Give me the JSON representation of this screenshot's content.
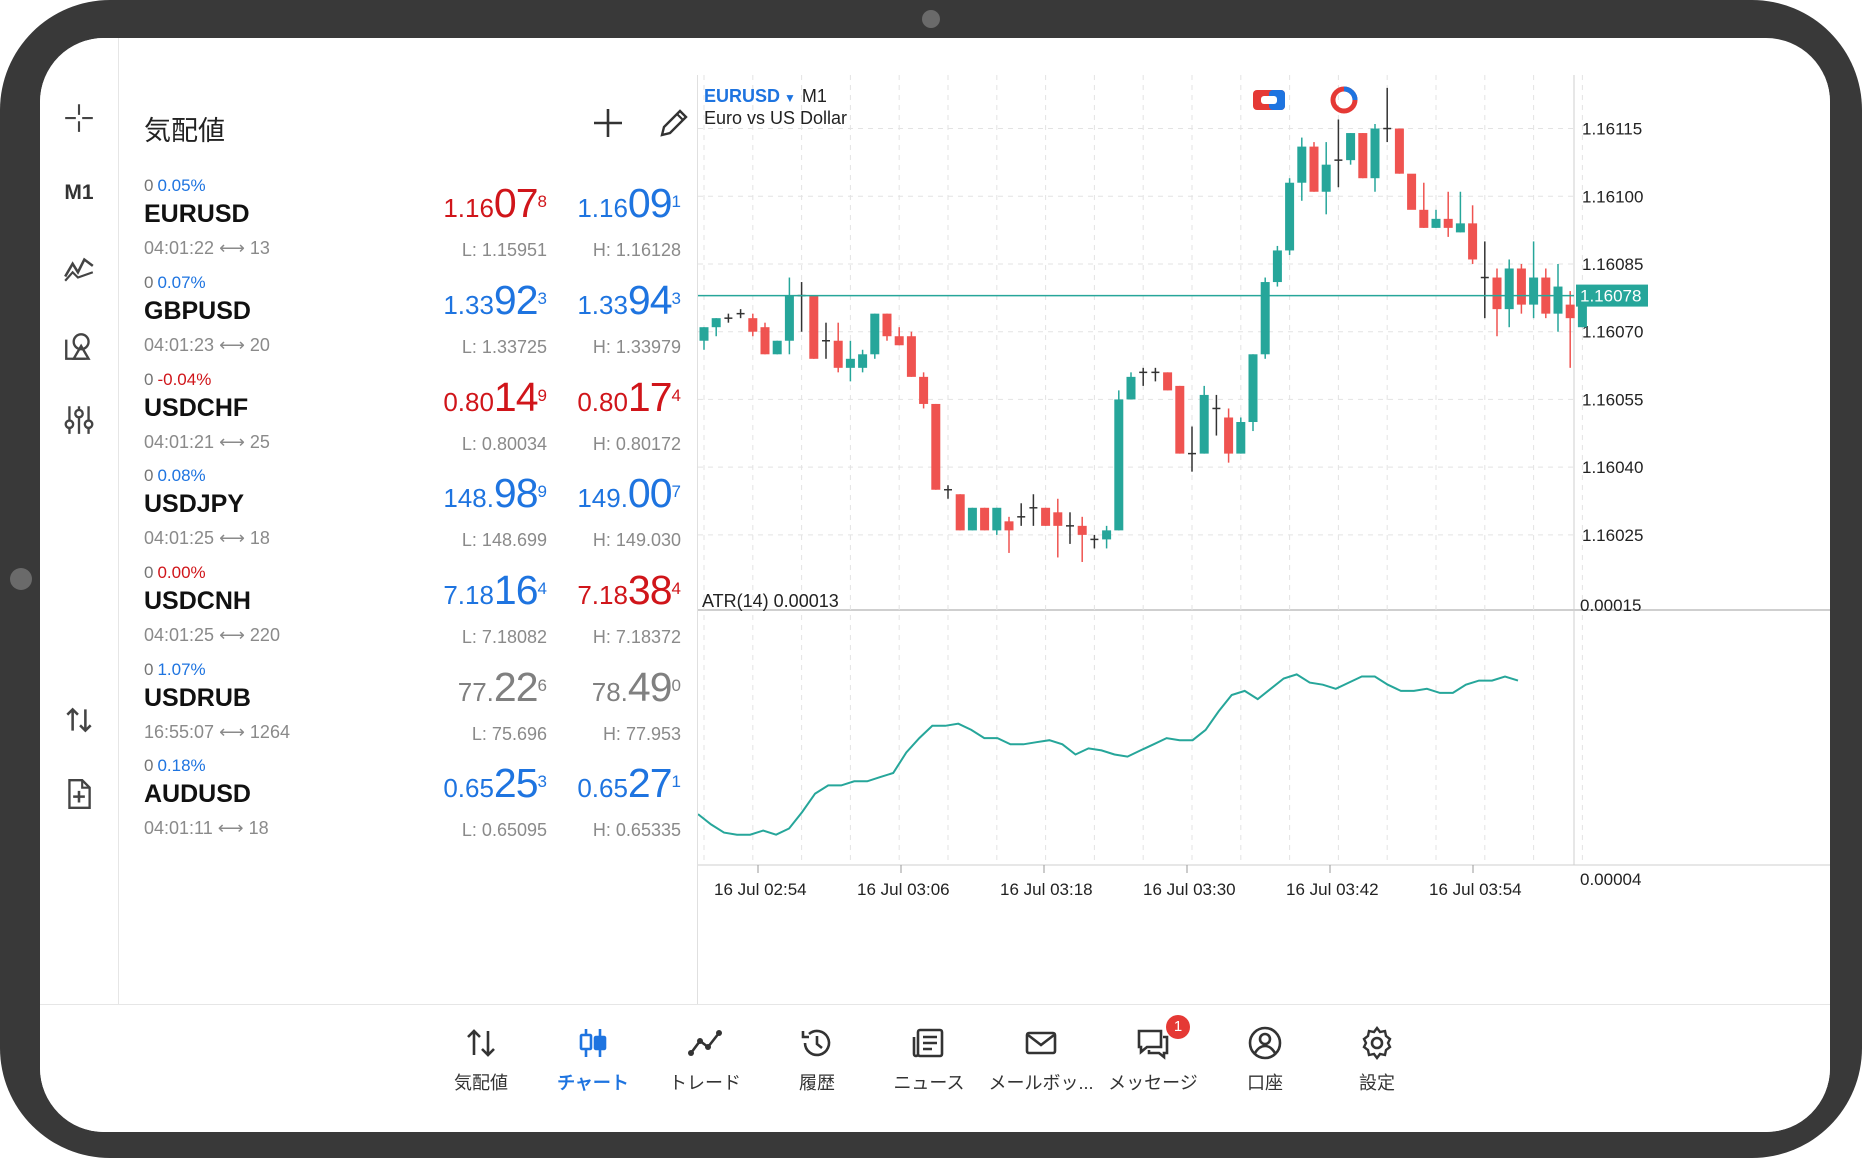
{
  "rail": {
    "timeframe": "M1"
  },
  "quotes": {
    "title": "気配値",
    "rows": [
      {
        "change_zero": "0",
        "pct": "0.05%",
        "pct_color": "blue",
        "symbol": "EURUSD",
        "time": "04:01:22",
        "spread": "13",
        "bid": {
          "s": "1.16",
          "b": "07",
          "x": "8",
          "color": "red"
        },
        "ask": {
          "s": "1.16",
          "b": "09",
          "x": "1",
          "color": "blue"
        },
        "low": "L: 1.15951",
        "high": "H: 1.16128"
      },
      {
        "change_zero": "0",
        "pct": "0.07%",
        "pct_color": "blue",
        "symbol": "GBPUSD",
        "time": "04:01:23",
        "spread": "20",
        "bid": {
          "s": "1.33",
          "b": "92",
          "x": "3",
          "color": "blue"
        },
        "ask": {
          "s": "1.33",
          "b": "94",
          "x": "3",
          "color": "blue"
        },
        "low": "L: 1.33725",
        "high": "H: 1.33979"
      },
      {
        "change_zero": "0",
        "pct": "-0.04%",
        "pct_color": "red",
        "symbol": "USDCHF",
        "time": "04:01:21",
        "spread": "25",
        "bid": {
          "s": "0.80",
          "b": "14",
          "x": "9",
          "color": "red"
        },
        "ask": {
          "s": "0.80",
          "b": "17",
          "x": "4",
          "color": "red"
        },
        "low": "L: 0.80034",
        "high": "H: 0.80172"
      },
      {
        "change_zero": "0",
        "pct": "0.08%",
        "pct_color": "blue",
        "symbol": "USDJPY",
        "time": "04:01:25",
        "spread": "18",
        "bid": {
          "s": "148.",
          "b": "98",
          "x": "9",
          "color": "blue"
        },
        "ask": {
          "s": "149.",
          "b": "00",
          "x": "7",
          "color": "blue"
        },
        "low": "L: 148.699",
        "high": "H: 149.030"
      },
      {
        "change_zero": "0",
        "pct": "0.00%",
        "pct_color": "red",
        "symbol": "USDCNH",
        "time": "04:01:25",
        "spread": "220",
        "bid": {
          "s": "7.18",
          "b": "16",
          "x": "4",
          "color": "blue"
        },
        "ask": {
          "s": "7.18",
          "b": "38",
          "x": "4",
          "color": "red"
        },
        "low": "L: 7.18082",
        "high": "H: 7.18372"
      },
      {
        "change_zero": "0",
        "pct": "1.07%",
        "pct_color": "blue",
        "symbol": "USDRUB",
        "time": "16:55:07",
        "spread": "1264",
        "bid": {
          "s": "77.",
          "b": "22",
          "x": "6",
          "color": "gray"
        },
        "ask": {
          "s": "78.",
          "b": "49",
          "x": "0",
          "color": "gray"
        },
        "low": "L: 75.696",
        "high": "H: 77.953"
      },
      {
        "change_zero": "0",
        "pct": "0.18%",
        "pct_color": "blue",
        "symbol": "AUDUSD",
        "time": "04:01:11",
        "spread": "18",
        "bid": {
          "s": "0.65",
          "b": "25",
          "x": "3",
          "color": "blue"
        },
        "ask": {
          "s": "0.65",
          "b": "27",
          "x": "1",
          "color": "blue"
        },
        "low": "L: 0.65095",
        "high": "H: 0.65335"
      }
    ]
  },
  "chart": {
    "symbol": "EURUSD",
    "timeframe": "M1",
    "description": "Euro vs US Dollar",
    "atr_label": "ATR(14) 0.00013",
    "current_price": "1.16078",
    "colors": {
      "bull": "#26a69a",
      "bear": "#ef5350",
      "line": "#26a69a",
      "grid": "#e3e3e3",
      "price_tag": "#26a69a"
    }
  },
  "chart_data": {
    "type": "candlestick",
    "price_axis": {
      "ticks": [
        "1.16115",
        "1.16100",
        "1.16085",
        "1.16070",
        "1.16055",
        "1.16040",
        "1.16025"
      ],
      "min": 1.16017,
      "max": 1.16118
    },
    "atr_axis": {
      "ticks": [
        "0.00015",
        "0.00004"
      ],
      "min": 4e-05,
      "max": 0.00015
    },
    "x_ticks": [
      "16 Jul 02:54",
      "16 Jul 03:06",
      "16 Jul 03:18",
      "16 Jul 03:30",
      "16 Jul 03:42",
      "16 Jul 03:54"
    ],
    "candles": [
      [
        1.16068,
        1.16071,
        1.16066,
        1.16071
      ],
      [
        1.16071,
        1.16073,
        1.16069,
        1.16073
      ],
      [
        1.16073,
        1.16074,
        1.16072,
        1.16073
      ],
      [
        1.16073,
        1.16075,
        1.16073,
        1.16074
      ],
      [
        1.16073,
        1.16074,
        1.16069,
        1.1607
      ],
      [
        1.16071,
        1.16072,
        1.16065,
        1.16065
      ],
      [
        1.16065,
        1.16068,
        1.16065,
        1.16068
      ],
      [
        1.16068,
        1.16082,
        1.16065,
        1.16078
      ],
      [
        1.16078,
        1.16081,
        1.1607,
        1.16078
      ],
      [
        1.16078,
        1.16078,
        1.16064,
        1.16064
      ],
      [
        1.16068,
        1.16072,
        1.16064,
        1.16068
      ],
      [
        1.16068,
        1.16072,
        1.16061,
        1.16062
      ],
      [
        1.16062,
        1.16068,
        1.16059,
        1.16064
      ],
      [
        1.16062,
        1.16066,
        1.16061,
        1.16065
      ],
      [
        1.16065,
        1.16074,
        1.16064,
        1.16074
      ],
      [
        1.16074,
        1.16074,
        1.16068,
        1.16069
      ],
      [
        1.16069,
        1.16071,
        1.16067,
        1.16067
      ],
      [
        1.16069,
        1.1607,
        1.1606,
        1.1606
      ],
      [
        1.1606,
        1.16061,
        1.16053,
        1.16054
      ],
      [
        1.16054,
        1.16054,
        1.16035,
        1.16035
      ],
      [
        1.16035,
        1.16036,
        1.16033,
        1.16034
      ],
      [
        1.16034,
        1.16034,
        1.16026,
        1.16026
      ],
      [
        1.16026,
        1.16031,
        1.16026,
        1.16031
      ],
      [
        1.16031,
        1.16031,
        1.16026,
        1.16026
      ],
      [
        1.16026,
        1.16031,
        1.16025,
        1.16031
      ],
      [
        1.16028,
        1.16029,
        1.16021,
        1.16026
      ],
      [
        1.16028,
        1.16032,
        1.16027,
        1.16029
      ],
      [
        1.16031,
        1.16034,
        1.16027,
        1.16031
      ],
      [
        1.16031,
        1.16031,
        1.16027,
        1.16027
      ],
      [
        1.1603,
        1.16033,
        1.1602,
        1.16027
      ],
      [
        1.16027,
        1.1603,
        1.16023,
        1.16027
      ],
      [
        1.16027,
        1.16029,
        1.16019,
        1.16025
      ],
      [
        1.16024,
        1.16025,
        1.16022,
        1.16024
      ],
      [
        1.16024,
        1.16027,
        1.16022,
        1.16026
      ],
      [
        1.16026,
        1.16057,
        1.16026,
        1.16055
      ],
      [
        1.16055,
        1.16061,
        1.16055,
        1.1606
      ],
      [
        1.1606,
        1.16062,
        1.16058,
        1.16061
      ],
      [
        1.16061,
        1.16062,
        1.16059,
        1.16061
      ],
      [
        1.16061,
        1.16061,
        1.16057,
        1.16057
      ],
      [
        1.16058,
        1.16058,
        1.16043,
        1.16043
      ],
      [
        1.16043,
        1.16049,
        1.16039,
        1.16043
      ],
      [
        1.16043,
        1.16058,
        1.16043,
        1.16056
      ],
      [
        1.16053,
        1.16056,
        1.16047,
        1.16052
      ],
      [
        1.16051,
        1.16053,
        1.16041,
        1.16043
      ],
      [
        1.16043,
        1.16051,
        1.16043,
        1.1605
      ],
      [
        1.1605,
        1.16065,
        1.16048,
        1.16065
      ],
      [
        1.16065,
        1.16082,
        1.16064,
        1.16081
      ],
      [
        1.16081,
        1.16089,
        1.1608,
        1.16088
      ],
      [
        1.16088,
        1.16104,
        1.16087,
        1.16103
      ],
      [
        1.16103,
        1.16113,
        1.16099,
        1.16111
      ],
      [
        1.16111,
        1.16112,
        1.16101,
        1.16101
      ],
      [
        1.16101,
        1.16112,
        1.16096,
        1.16107
      ],
      [
        1.16107,
        1.16117,
        1.16102,
        1.16108
      ],
      [
        1.16108,
        1.16114,
        1.16107,
        1.16114
      ],
      [
        1.16114,
        1.16114,
        1.16104,
        1.16104
      ],
      [
        1.16104,
        1.16116,
        1.16101,
        1.16115
      ],
      [
        1.16115,
        1.16124,
        1.16112,
        1.16115
      ],
      [
        1.16115,
        1.16115,
        1.16105,
        1.16105
      ],
      [
        1.16105,
        1.16104,
        1.16098,
        1.16097
      ],
      [
        1.16097,
        1.16103,
        1.16093,
        1.16093
      ],
      [
        1.16093,
        1.16097,
        1.16093,
        1.16095
      ],
      [
        1.16095,
        1.16101,
        1.16091,
        1.16093
      ],
      [
        1.16092,
        1.16101,
        1.16092,
        1.16094
      ],
      [
        1.16094,
        1.16098,
        1.16085,
        1.16086
      ],
      [
        1.16082,
        1.1609,
        1.16073,
        1.16082
      ],
      [
        1.16082,
        1.16084,
        1.16069,
        1.16075
      ],
      [
        1.16075,
        1.16086,
        1.16071,
        1.16084
      ],
      [
        1.16084,
        1.16085,
        1.16074,
        1.16076
      ],
      [
        1.16076,
        1.1609,
        1.16073,
        1.16082
      ],
      [
        1.16082,
        1.16084,
        1.16073,
        1.16074
      ],
      [
        1.16074,
        1.16085,
        1.1607,
        1.1608
      ],
      [
        1.16076,
        1.16079,
        1.16062,
        1.16073
      ],
      [
        1.16071,
        1.16078,
        1.16071,
        1.16078
      ]
    ],
    "atr": [
      5.6e-05,
      5.1e-05,
      4.7e-05,
      4.6e-05,
      4.6e-05,
      4.8e-05,
      4.6e-05,
      4.9e-05,
      5.7e-05,
      6.6e-05,
      7e-05,
      7e-05,
      7.2e-05,
      7.2e-05,
      7.4e-05,
      7.6e-05,
      8.6e-05,
      9.3e-05,
      9.9e-05,
      9.9e-05,
      0.0001,
      9.7e-05,
      9.3e-05,
      9.3e-05,
      9e-05,
      9e-05,
      9.1e-05,
      9.2e-05,
      9e-05,
      8.5e-05,
      8.8e-05,
      8.7e-05,
      8.5e-05,
      8.4e-05,
      8.7e-05,
      9e-05,
      9.3e-05,
      9.2e-05,
      9.2e-05,
      9.7e-05,
      0.000106,
      0.000114,
      0.000116,
      0.000112,
      0.000117,
      0.000122,
      0.000124,
      0.00012,
      0.000119,
      0.000117,
      0.00012,
      0.000123,
      0.000123,
      0.000119,
      0.000116,
      0.000116,
      0.000117,
      0.000115,
      0.000115,
      0.000119,
      0.000121,
      0.000121,
      0.000123,
      0.000121
    ]
  },
  "bottomnav": {
    "items": [
      {
        "label": "気配値"
      },
      {
        "label": "チャート"
      },
      {
        "label": "トレード"
      },
      {
        "label": "履歴"
      },
      {
        "label": "ニュース"
      },
      {
        "label": "メールボッ..."
      },
      {
        "label": "メッセージ",
        "badge": "1"
      },
      {
        "label": "口座"
      },
      {
        "label": "設定"
      }
    ]
  }
}
